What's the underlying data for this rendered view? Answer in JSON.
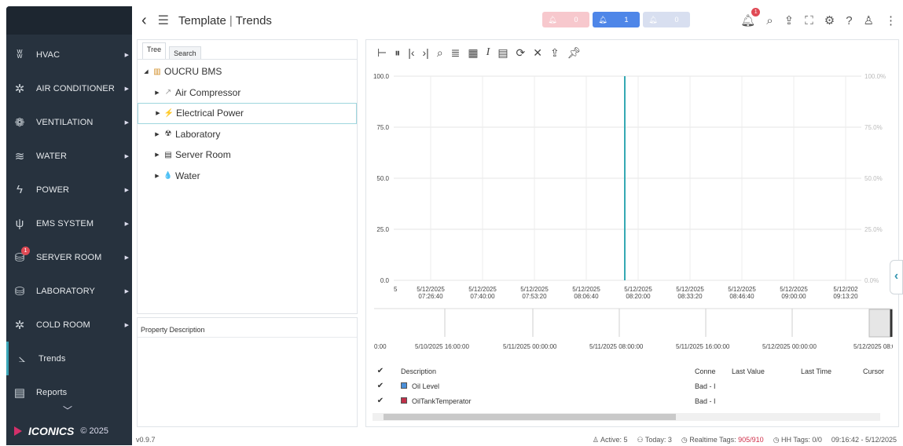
{
  "sidebar": {
    "items": [
      {
        "label": "HVAC",
        "icon": "hvac-icon",
        "glyph": "ʬ"
      },
      {
        "label": "AIR CONDITIONER",
        "icon": "snowflake-icon",
        "glyph": "✲"
      },
      {
        "label": "VENTILATION",
        "icon": "fan-icon",
        "glyph": "❁"
      },
      {
        "label": "WATER",
        "icon": "water-waves-icon",
        "glyph": "≋"
      },
      {
        "label": "POWER",
        "icon": "lightning-icon",
        "glyph": "ϟ"
      },
      {
        "label": "EMS SYSTEM",
        "icon": "plug-icon",
        "glyph": "ψ"
      },
      {
        "label": "SERVER ROOM",
        "icon": "database-icon",
        "glyph": "⛁",
        "badge": "1"
      },
      {
        "label": "LABORATORY",
        "icon": "lab-icon",
        "glyph": "⛁"
      },
      {
        "label": "COLD ROOM",
        "icon": "snowflake-icon",
        "glyph": "✲"
      },
      {
        "label": "Trends",
        "icon": "trend-chart-icon",
        "glyph": "⦣"
      },
      {
        "label": "Reports",
        "icon": "report-icon",
        "glyph": "▤"
      }
    ],
    "brand": "ICONICS",
    "copyright": "© 2025"
  },
  "header": {
    "title": "Template",
    "subtitle": "Trends",
    "alarms": [
      {
        "count": "0",
        "color": "#f7c8cd"
      },
      {
        "count": "1",
        "color": "#4e86e8"
      },
      {
        "count": "0",
        "color": "#d8dff0"
      }
    ],
    "notif_badge": "1"
  },
  "tree": {
    "tabs": [
      "Tree",
      "Search"
    ],
    "root": "OUCRU BMS",
    "nodes": [
      {
        "label": "Air Compressor",
        "icon": "compressor-icon",
        "glyph": "↗"
      },
      {
        "label": "Electrical Power",
        "icon": "lightning-icon",
        "glyph": "⚡"
      },
      {
        "label": "Laboratory",
        "icon": "lab-icon",
        "glyph": "☢"
      },
      {
        "label": "Server Room",
        "icon": "server-icon",
        "glyph": "▤"
      },
      {
        "label": "Water",
        "icon": "water-drop-icon",
        "glyph": "💧"
      }
    ]
  },
  "property": {
    "header": "Property  Description"
  },
  "chart_data": {
    "type": "line",
    "yticks_left": [
      "100.0",
      "75.0",
      "50.0",
      "25.0",
      "0.0"
    ],
    "yticks_right": [
      "100.0%",
      "75.0%",
      "50.0%",
      "25.0%",
      "0.0%"
    ],
    "ylim": [
      0,
      100
    ],
    "xticks": [
      {
        "d": "5/12/2025",
        "t": "07:26:40"
      },
      {
        "d": "5/12/2025",
        "t": "07:40:00"
      },
      {
        "d": "5/12/2025",
        "t": "07:53:20"
      },
      {
        "d": "5/12/2025",
        "t": "08:06:40"
      },
      {
        "d": "5/12/2025",
        "t": "08:20:00"
      },
      {
        "d": "5/12/2025",
        "t": "08:33:20"
      },
      {
        "d": "5/12/2025",
        "t": "08:46:40"
      },
      {
        "d": "5/12/2025",
        "t": "09:00:00"
      },
      {
        "d": "5/12/202",
        "t": "09:13:20"
      }
    ],
    "xprefix": "5",
    "cursor_time": "08:20:00",
    "nav_ticks": [
      "0:00",
      "5/10/2025 16:00:00",
      "5/11/2025 00:00:00",
      "5/11/2025 08:00:00",
      "5/11/2025 16:00:00",
      "5/12/2025 00:00:00",
      "5/12/2025 08:0"
    ],
    "grid": true
  },
  "table": {
    "headers": {
      "desc": "Description",
      "conn": "Conne",
      "last_value": "Last Value",
      "last_time": "Last Time",
      "cursor": "Cursor"
    },
    "rows": [
      {
        "desc": "Oil Level",
        "conn": "Bad - I",
        "color": "#4a8fd8"
      },
      {
        "desc": "OilTankTemperator",
        "conn": "Bad - I",
        "color": "#c0304a"
      }
    ]
  },
  "status": {
    "version": "v0.9.7",
    "active": "Active: 5",
    "today": "Today: 3",
    "realtime_label": "Realtime Tags:",
    "realtime_value": "905/910",
    "hh": "HH Tags: 0/0",
    "datetime": "09:16:42 - 5/12/2025"
  }
}
